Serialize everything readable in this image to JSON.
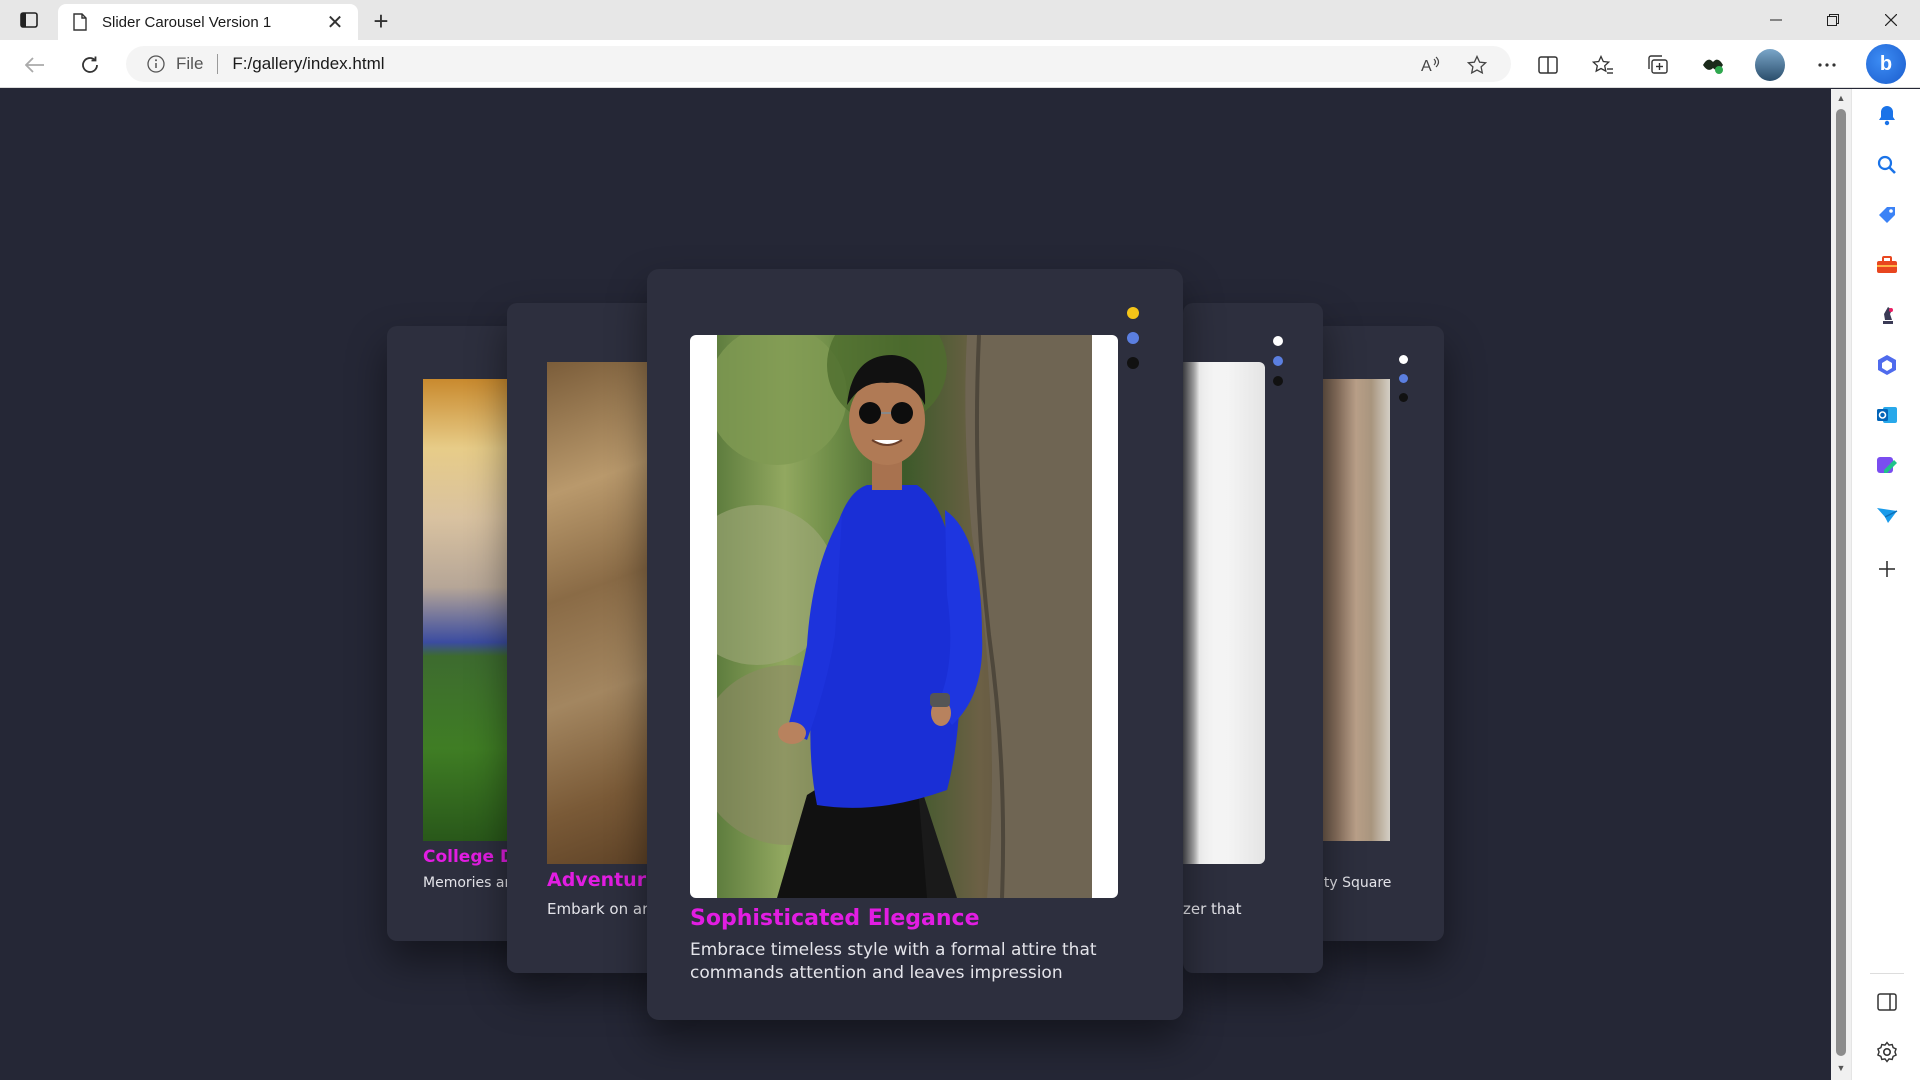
{
  "browser": {
    "tab_title": "Slider Carousel Version 1",
    "new_tab_label": "+",
    "close_tab_label": "✕",
    "scheme_label": "File",
    "url": "F:/gallery/index.html"
  },
  "carousel": {
    "center": {
      "title": "Sophisticated Elegance",
      "description": "Embrace timeless style with a formal attire that commands attention and leaves impression"
    },
    "near_left": {
      "title": "Adventure",
      "description": "Embark on an horizons"
    },
    "far_left": {
      "title": "College Do",
      "description": "Memories ar and nostalgic"
    },
    "near_right": {
      "description": "zer that"
    },
    "far_right": {
      "description": "ity Square"
    },
    "dot_colors": [
      "#f5c518",
      "#5b7fe0",
      "#111111"
    ],
    "side_dot_colors": [
      "#ffffff",
      "#5b7fe0",
      "#111111"
    ]
  },
  "colors": {
    "page_bg": "#252736",
    "card_bg": "#2d2f3e",
    "title_accent": "#e21de2"
  },
  "icons": {
    "toolbar": [
      "read-aloud-icon",
      "favorite-star-icon",
      "split-screen-icon",
      "favorites-icon",
      "collections-icon",
      "extensions-icon",
      "profile-avatar",
      "more-menu-icon",
      "copilot-icon"
    ],
    "sidebar": [
      "notifications-icon",
      "search-icon",
      "shopping-icon",
      "tools-icon",
      "games-icon",
      "microsoft365-icon",
      "outlook-icon",
      "designer-icon",
      "send-icon",
      "add-icon",
      "sidebar-layout-icon",
      "settings-icon"
    ]
  }
}
